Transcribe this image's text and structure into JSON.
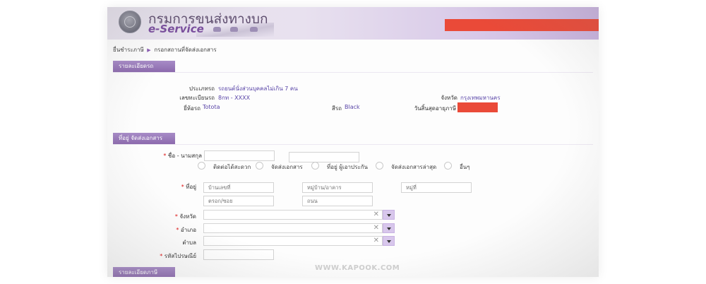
{
  "header": {
    "title": "กรมการขนส่งทางบก",
    "subtitle": "e-Service"
  },
  "breadcrumb": {
    "root": "ยื่นชำระภาษี",
    "separator": "▶",
    "current": "กรอกสถานที่จัดส่งเอกสาร"
  },
  "vehicle_section": {
    "title": "รายละเอียดรถ",
    "type_label": "ประเภทรถ",
    "type_value": "รถยนต์นั่งส่วนบุคคลไม่เกิน 7 คน",
    "plate_label": "เลขทะเบียนรถ",
    "plate_value": "8กท - XXXX",
    "province_label": "จังหวัด",
    "province_value": "กรุงเทพมหานคร",
    "brand_label": "ยี่ห้อรถ",
    "brand_value": "Totota",
    "color_label": "สีรถ",
    "color_value": "Black",
    "expiry_label": "วันสิ้นสุดอายุภาษี"
  },
  "address_section": {
    "title": "ที่อยู่ จัดส่งเอกสาร",
    "name_label": "ชื่อ - นามสกุล",
    "first_name_value": "",
    "last_name_value": "",
    "address_options": [
      "ติดต่อได้สะดวก",
      "จัดส่งเอกสาร",
      "ที่อยู่ ผู้เอาประกัน",
      "จัดส่งเอกสารล่าสุด",
      "อื่นๆ"
    ],
    "address_label": "ที่อยู่",
    "house_no_placeholder": "บ้านเลขที่",
    "village_placeholder": "หมู่บ้าน/อาคาร",
    "moo_placeholder": "หมู่ที่",
    "soi_placeholder": "ตรอก/ซอย",
    "road_placeholder": "ถนน",
    "province_label": "จังหวัด",
    "district_label": "อำเภอ",
    "subdistrict_label": "ตำบล",
    "postcode_label": "รหัสไปรษณีย์",
    "clear_symbol": "✕",
    "required_mark": "*"
  },
  "tax_section": {
    "title": "รายละเอียดภาษี"
  },
  "watermark": "WWW.KAPOOK.COM",
  "colors": {
    "accent": "#8c6aad",
    "redaction": "#ea4a38",
    "value_text": "#5a46a8"
  }
}
